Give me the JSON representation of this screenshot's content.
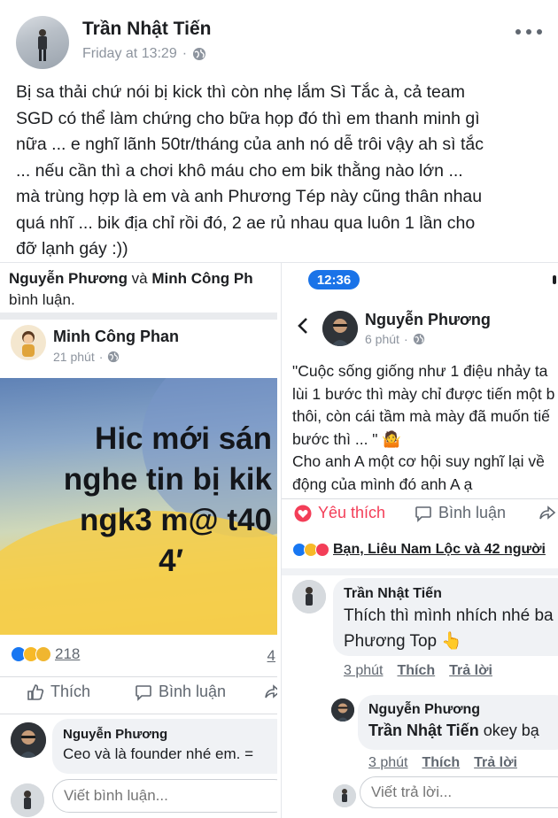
{
  "post": {
    "author": "Trần Nhật Tiến",
    "time": "Friday at 13:29",
    "separator": "·",
    "lines": [
      "Bị sa thải chứ nói bị kick thì còn nhẹ lắm  Sì Tắc à, cả team",
      "SGD có thể làm chứng cho bữa họp đó thì em thanh minh gì",
      "nữa ... e nghĩ lãnh 50tr/tháng của anh nó dễ trôi vậy ah sì tắc",
      "... nếu cần thì a chơi khô máu cho em bik thằng nào lớn ...",
      "mà trùng hợp là em và anh Phương Tép này cũng thân nhau",
      "quá nhĩ ... bik địa chỉ rồi đó, 2 ae rủ nhau qua luôn 1 lần cho",
      "đỡ lạnh gáy  :))"
    ]
  },
  "left": {
    "notice_name1": "Nguyễn Phương",
    "notice_and": " và ",
    "notice_name2": "Minh Công Ph",
    "notice_rest": "bình luận.",
    "author": "Minh Công Phan",
    "time": "21 phút",
    "separator": "·",
    "caption": [
      "Hic mới sán",
      "nghe tin bị kik",
      "ngk3 m@ t40",
      "4′"
    ],
    "reaction_count": "218",
    "comment_count": "4",
    "like_label": "Thích",
    "comment_label": "Bình luận",
    "comment_author": "Nguyễn Phương",
    "comment_text": "Ceo và là founder nhé em. =",
    "write_placeholder": "Viết bình luận..."
  },
  "right": {
    "status_time": "12:36",
    "author": "Nguyễn Phương",
    "time": "6 phút",
    "separator": "·",
    "lines": [
      "\"Cuộc sống giống như 1 điệu nhảy ta",
      "lùi 1 bước thì mày chỉ được tiến một b",
      "thôi, còn cái tầm mà mày đã muốn tiế",
      "bước thì ... \" 🤷",
      "Cho anh A một cơ hội suy nghĩ lại về",
      "động của mình đó anh A ạ"
    ],
    "love_label": "Yêu thích",
    "comment_label": "Bình luận",
    "reactors": "Bạn, Liêu Nam Lộc và 42 người",
    "c1_author": "Trần Nhật Tiến",
    "c1_line1": "Thích thì mình nhích nhé ba",
    "c1_line2": "Phương Top 👆",
    "c1_time": "3 phút",
    "c1_like": "Thích",
    "c1_reply": "Trả lời",
    "c2_author": "Nguyễn Phương",
    "c2_mention": "Trần Nhật Tiến",
    "c2_text": " okey bạ",
    "c2_time": "3 phút",
    "c2_like": "Thích",
    "c2_reply": "Trả lời",
    "reply_placeholder": "Viết trả lời..."
  },
  "colors": {
    "text": "#1c1e21",
    "muted": "#606770",
    "like_blue": "#1877f2",
    "love_red": "#f33e58",
    "status_blue": "#1a73e8"
  },
  "icons": [
    "globe-icon",
    "more-icon",
    "like-icon",
    "comment-icon",
    "share-icon",
    "heart-icon",
    "back-icon",
    "haha-icon",
    "sad-icon"
  ]
}
